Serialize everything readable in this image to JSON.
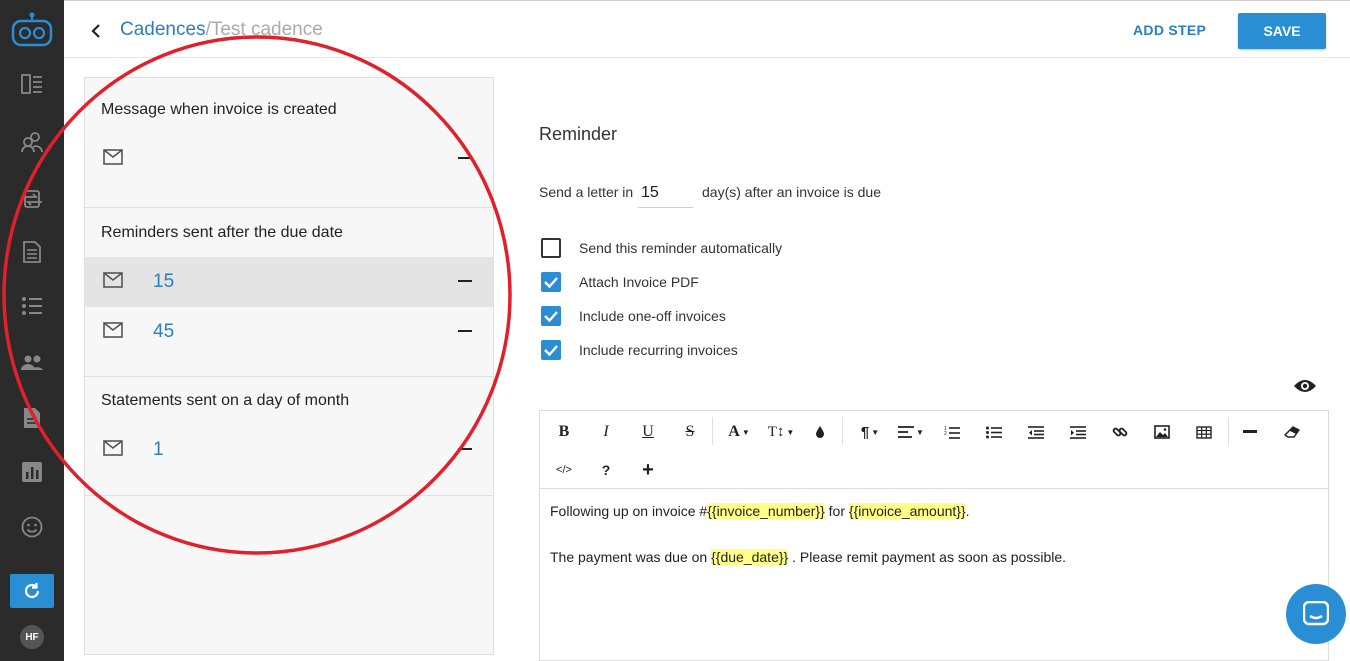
{
  "header": {
    "breadcrumb_link": "Cadences",
    "breadcrumb_sep": "/",
    "breadcrumb_current": "Test cadence",
    "add_step_label": "ADD STEP",
    "save_label": "SAVE"
  },
  "sidebar": {
    "items": [
      {
        "icon": "dashboard-icon"
      },
      {
        "icon": "customers-icon"
      },
      {
        "icon": "transactions-icon"
      },
      {
        "icon": "invoices-icon"
      },
      {
        "icon": "list-icon"
      },
      {
        "icon": "people-icon"
      },
      {
        "icon": "document-icon"
      },
      {
        "icon": "reports-icon"
      },
      {
        "icon": "smiley-icon"
      }
    ],
    "avatar_initials": "HF"
  },
  "steps": {
    "sections": [
      {
        "title": "Message when invoice is created",
        "rows": [
          {
            "value": ""
          }
        ]
      },
      {
        "title": "Reminders sent after the due date",
        "rows": [
          {
            "value": "15",
            "selected": true
          },
          {
            "value": "45"
          }
        ]
      },
      {
        "title": "Statements sent on a day of month",
        "rows": [
          {
            "value": "1"
          }
        ]
      }
    ]
  },
  "reminder": {
    "title": "Reminder",
    "days_prefix": "Send a letter in",
    "days_value": "15",
    "days_suffix": "day(s) after an invoice is due",
    "options": [
      {
        "label": "Send this reminder automatically",
        "checked": false
      },
      {
        "label": "Attach Invoice PDF",
        "checked": true
      },
      {
        "label": "Include one-off invoices",
        "checked": true
      },
      {
        "label": "Include recurring invoices",
        "checked": true
      }
    ]
  },
  "editor": {
    "toolbar": {
      "bold": "B",
      "italic": "I",
      "underline": "U",
      "strike": "S",
      "font": "A",
      "text_size": "T↕",
      "paragraph": "¶",
      "code": "</>",
      "help": "?",
      "add": "+"
    },
    "body": {
      "line1_prefix": "Following up on invoice #",
      "var_invoice_number": "{{invoice_number}}",
      "line1_mid": " for ",
      "var_invoice_amount": "{{invoice_amount}}",
      "line1_end": ".",
      "line2_prefix": "The payment was due on ",
      "var_due_date": "{{due_date}}",
      "line2_end": " . Please remit payment as soon as possible."
    }
  },
  "colors": {
    "accent": "#2a8ed4",
    "link": "#2a7fc0",
    "sidebar_bg": "#2b2b2b",
    "annotation": "#e0202a",
    "highlight": "#ffff88"
  }
}
